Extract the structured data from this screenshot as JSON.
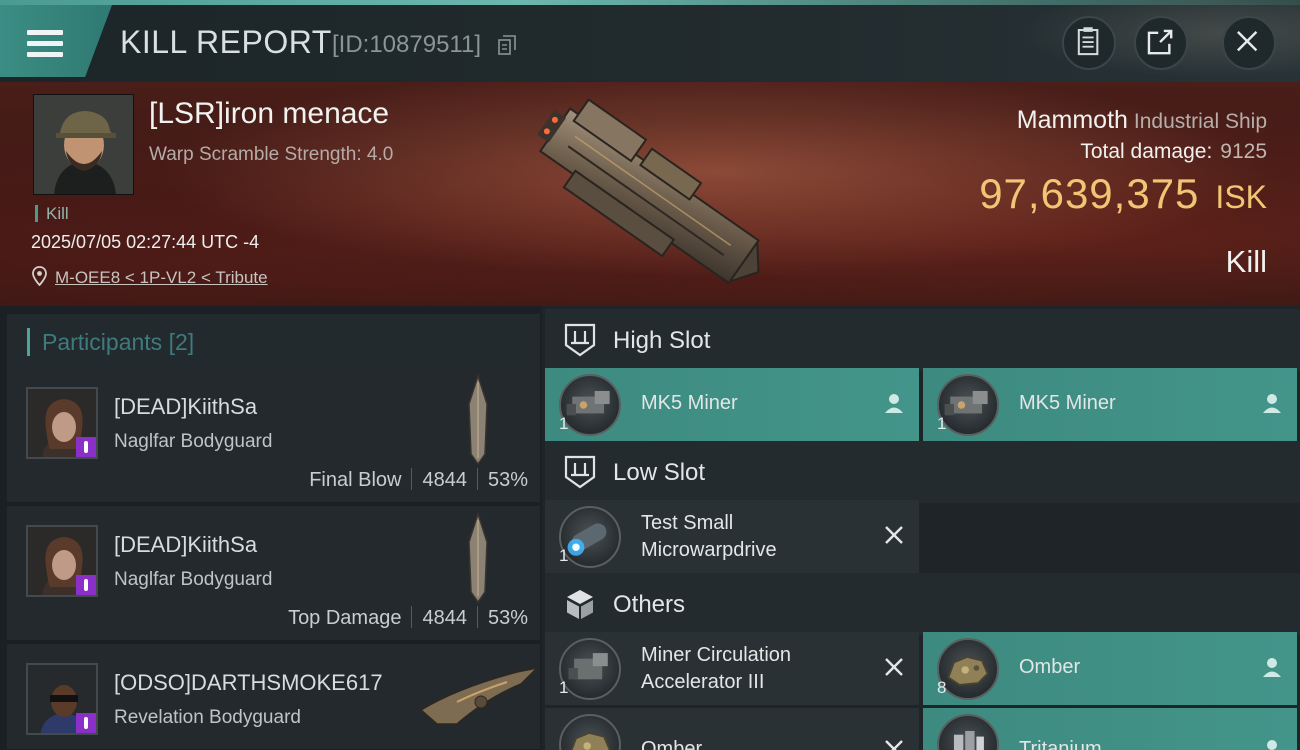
{
  "header": {
    "title": "KILL REPORT",
    "report_id": "[ID:10879511]",
    "icons": [
      "menu-icon",
      "copy-icon",
      "clipboard-icon",
      "share-icon",
      "close-icon"
    ]
  },
  "victim": {
    "pilot_name": "[LSR]iron menace",
    "scramble": "Warp Scramble Strength: 4.0",
    "tag": "Kill",
    "datetime": "2025/07/05 02:27:44 UTC -4",
    "location": "M-OEE8 < 1P-VL2 < Tribute",
    "ship_name": "Mammoth",
    "ship_class": "Industrial Ship",
    "total_damage_label": "Total damage:",
    "total_damage": "9125",
    "isk_value": "97,639,375",
    "isk_unit": "ISK",
    "result": "Kill"
  },
  "participants": {
    "title": "Participants",
    "count": "[2]",
    "list": [
      {
        "name": "[DEAD]KiithSa",
        "ship": "Naglfar Bodyguard",
        "role": "Final Blow",
        "damage": "4844",
        "percent": "53%"
      },
      {
        "name": "[DEAD]KiithSa",
        "ship": "Naglfar Bodyguard",
        "role": "Top Damage",
        "damage": "4844",
        "percent": "53%"
      },
      {
        "name": "[ODSO]DARTHSMOKE617",
        "ship": "Revelation Bodyguard",
        "role": "",
        "damage": "",
        "percent": ""
      }
    ]
  },
  "modules": {
    "high_slot": {
      "title": "High Slot",
      "items": [
        {
          "name": "MK5 Miner",
          "qty": "1",
          "status": "dropped"
        },
        {
          "name": "MK5 Miner",
          "qty": "1",
          "status": "dropped"
        }
      ]
    },
    "low_slot": {
      "title": "Low Slot",
      "items": [
        {
          "name_line1": "Test Small",
          "name_line2": "Microwarpdrive",
          "qty": "1",
          "status": "destroyed"
        }
      ]
    },
    "others": {
      "title": "Others",
      "items": [
        {
          "name_line1": "Miner Circulation",
          "name_line2": "Accelerator III",
          "qty": "1",
          "tier": "III",
          "status": "destroyed"
        },
        {
          "name": "Omber",
          "qty": "8",
          "status": "dropped"
        },
        {
          "name": "Omber",
          "qty": "",
          "status": "destroyed"
        },
        {
          "name": "Tritanium",
          "qty": "",
          "status": "dropped"
        }
      ]
    }
  },
  "colors": {
    "accent_teal": "#43958a",
    "isk_gold": "#f0c675",
    "badge_purple": "#8b2fc9"
  }
}
